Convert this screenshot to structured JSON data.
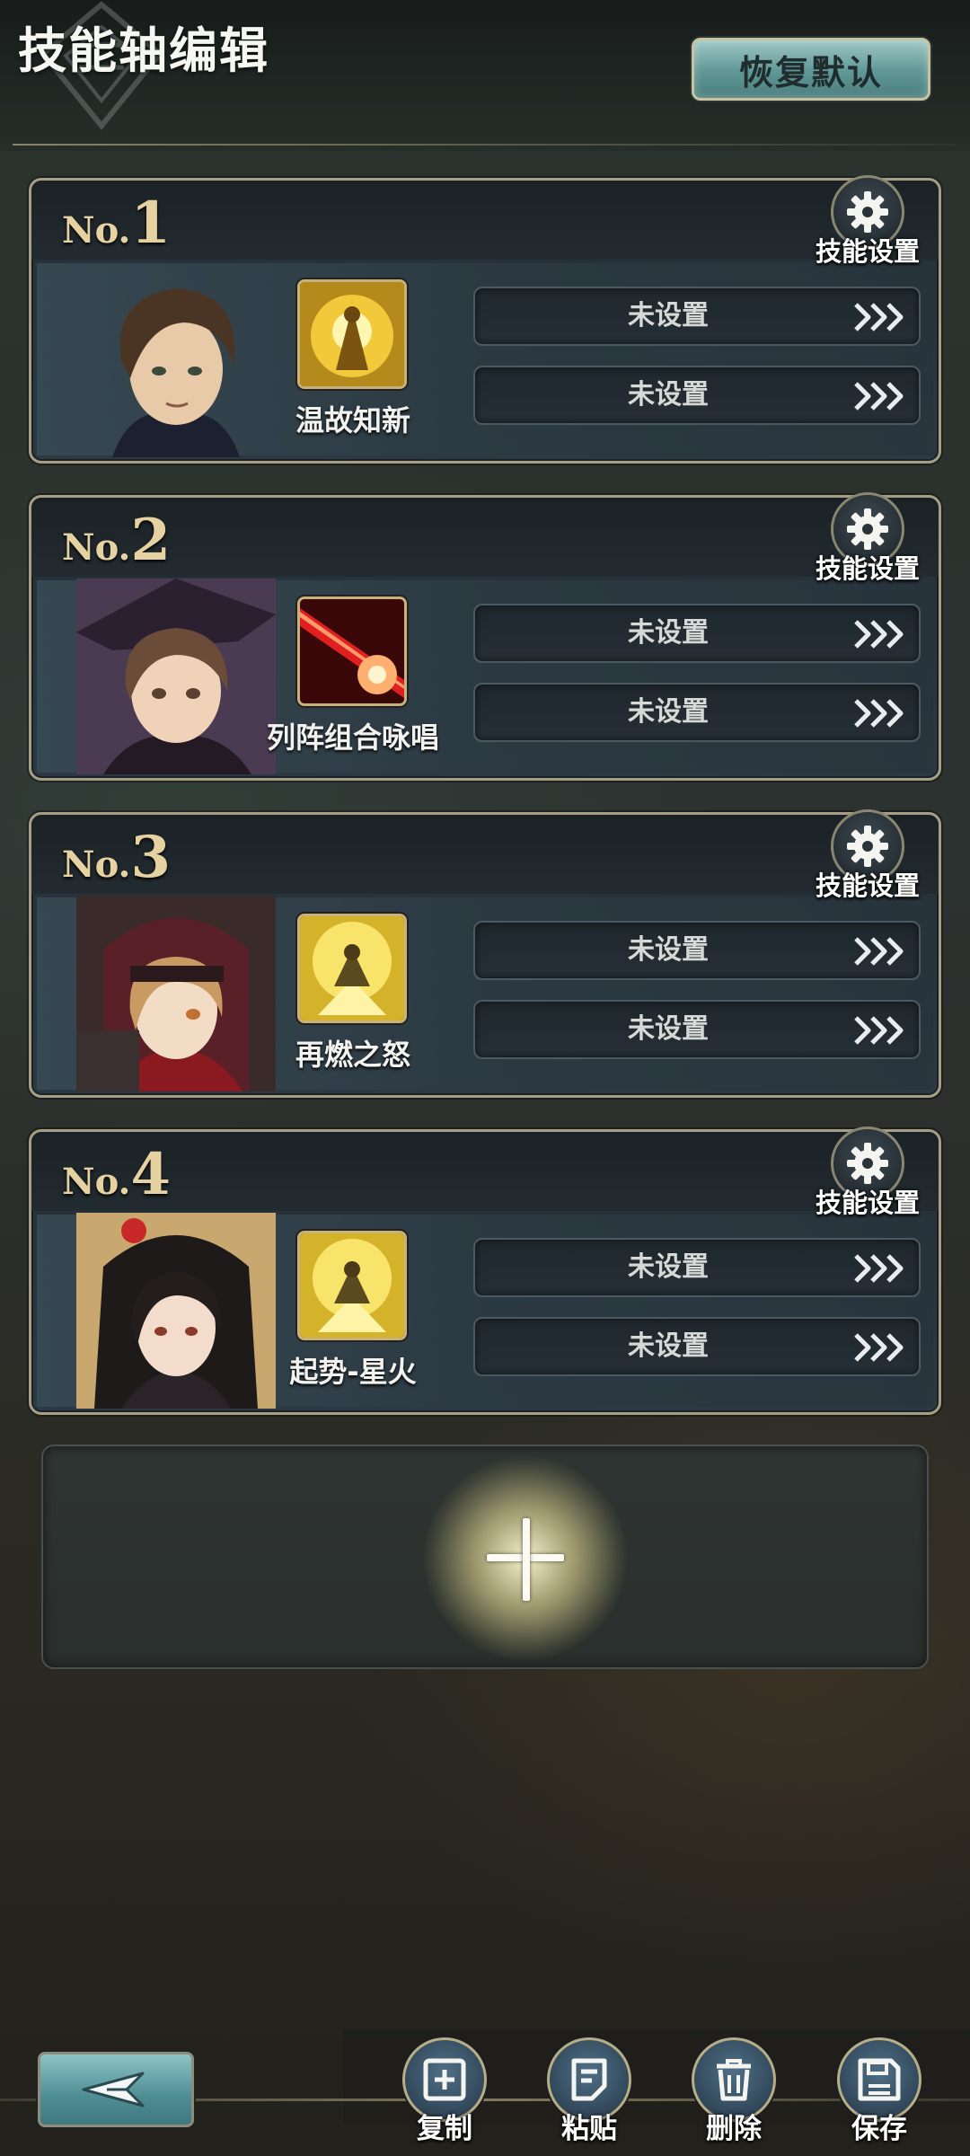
{
  "header": {
    "title": "技能轴编辑",
    "restore_label": "恢复默认"
  },
  "cards": [
    {
      "no_prefix": "No.",
      "number": "1",
      "gear_label": "技能设置",
      "skill_name": "温故知新",
      "slot1": "未设置",
      "slot2": "未设置"
    },
    {
      "no_prefix": "No.",
      "number": "2",
      "gear_label": "技能设置",
      "skill_name": "列阵组合咏唱",
      "slot1": "未设置",
      "slot2": "未设置"
    },
    {
      "no_prefix": "No.",
      "number": "3",
      "gear_label": "技能设置",
      "skill_name": "再燃之怒",
      "slot1": "未设置",
      "slot2": "未设置"
    },
    {
      "no_prefix": "No.",
      "number": "4",
      "gear_label": "技能设置",
      "skill_name": "起势-星火",
      "slot1": "未设置",
      "slot2": "未设置"
    }
  ],
  "add_panel": {
    "icon": "plus-icon"
  },
  "bottom_bar": {
    "back_icon": "back-arrow-icon",
    "actions": [
      {
        "label": "复制",
        "icon": "copy-icon"
      },
      {
        "label": "粘贴",
        "icon": "paste-icon"
      },
      {
        "label": "删除",
        "icon": "trash-icon"
      },
      {
        "label": "保存",
        "icon": "save-icon"
      }
    ]
  },
  "colors": {
    "accent_teal": "#5f9796",
    "gold": "#e6d2a0",
    "card_border": "#a69f85"
  }
}
